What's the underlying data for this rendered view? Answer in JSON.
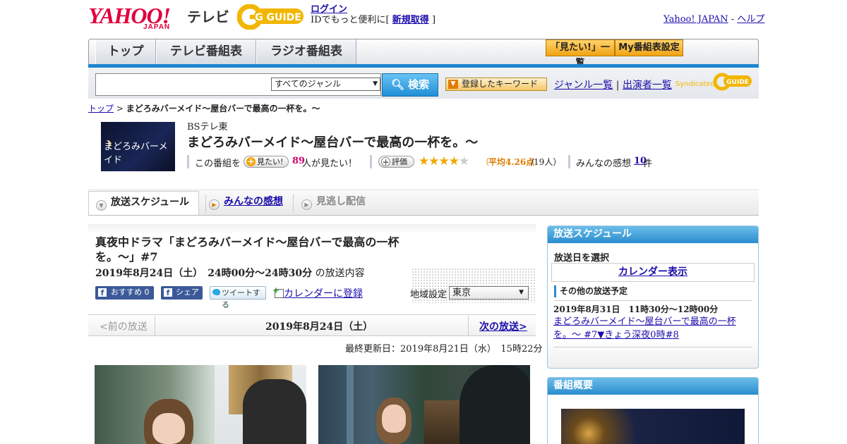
{
  "header": {
    "logo_text": "YAHOO!",
    "logo_sub": "JAPAN",
    "section_label": "テレビ",
    "gguide_text": "G GUIDE",
    "login_link": "ログイン",
    "login_desc": "IDでもっと便利に[",
    "signup_link": "新規取得",
    "signup_close": "]",
    "yahoo_japan_link": "Yahoo! JAPAN",
    "separator": "-",
    "help_link": "ヘルプ"
  },
  "nav": {
    "tabs": [
      {
        "label": "トップ"
      },
      {
        "label": "テレビ番組表"
      },
      {
        "label": "ラジオ番組表"
      }
    ],
    "want_list_btn": "「見たい!」一覧",
    "my_schedule_btn": "My番組表設定"
  },
  "search": {
    "query": "",
    "genre_selected": "すべてのジャンル",
    "search_btn": "検索",
    "keyword_btn": "登録したキーワード",
    "genre_list_link": "ジャンル一覧",
    "divider": "|",
    "performer_list_link": "出演者一覧",
    "syndicated": "Syndicated"
  },
  "breadcrumb": {
    "home": "トップ",
    "sep": ">",
    "current": "まどろみバーメイド～屋台バーで最高の一杯を。～"
  },
  "program": {
    "thumb_title": "まどろみバーメイド",
    "channel": "BSテレ東",
    "title": "まどろみバーメイド～屋台バーで最高の一杯を。～",
    "want_prefix": "この番組を",
    "want_btn": "見たい!",
    "want_count": "89",
    "want_suffix": "人が見たい！",
    "rate_btn": "評価",
    "rating_stars": 4,
    "rating_avg_prefix": "（",
    "rating_avg_label": "平均4.26点",
    "rating_count": "/19人）",
    "reviews_label": "みんなの感想",
    "reviews_count": "10",
    "reviews_unit": "件"
  },
  "tabs": {
    "schedule": "放送スケジュール",
    "reviews": "みんなの感想",
    "vod": "見逃し配信"
  },
  "episode": {
    "title": "真夜中ドラマ「まどろみバーメイド～屋台バーで最高の一杯を。～」#7",
    "datetime": "2019年8月24日（土）　24時00分～24時30分",
    "datetime_suffix": "の放送内容",
    "fb_recommend": "おすすめ 0",
    "fb_share": "シェア",
    "tweet": "ツイートする",
    "calendar": "カレンダーに登録",
    "region_label": "地域設定",
    "region_value": "東京"
  },
  "pager": {
    "prev": "<前の放送",
    "current": "2019年8月24日（土）",
    "next": "次の放送>"
  },
  "updated": "最終更新日：2019年8月21日（水）　15時22分",
  "sidebar": {
    "schedule_title": "放送スケジュール",
    "select_date": "放送日を選択",
    "calendar_btn": "カレンダー表示",
    "other_title": "その他の放送予定",
    "other_date": "2019年8月31日　11時30分～12時00分",
    "other_link": "まどろみバーメイド～屋台バーで最高の一杯を。～ #7▼きょう深夜0時#8",
    "overview_title": "番組概要"
  },
  "colors": {
    "accent_blue": "#1d86d1",
    "brand_red": "#e0003c",
    "star": "#f0a800",
    "want_count": "#cc0066",
    "rating_avg": "#e07b00"
  }
}
